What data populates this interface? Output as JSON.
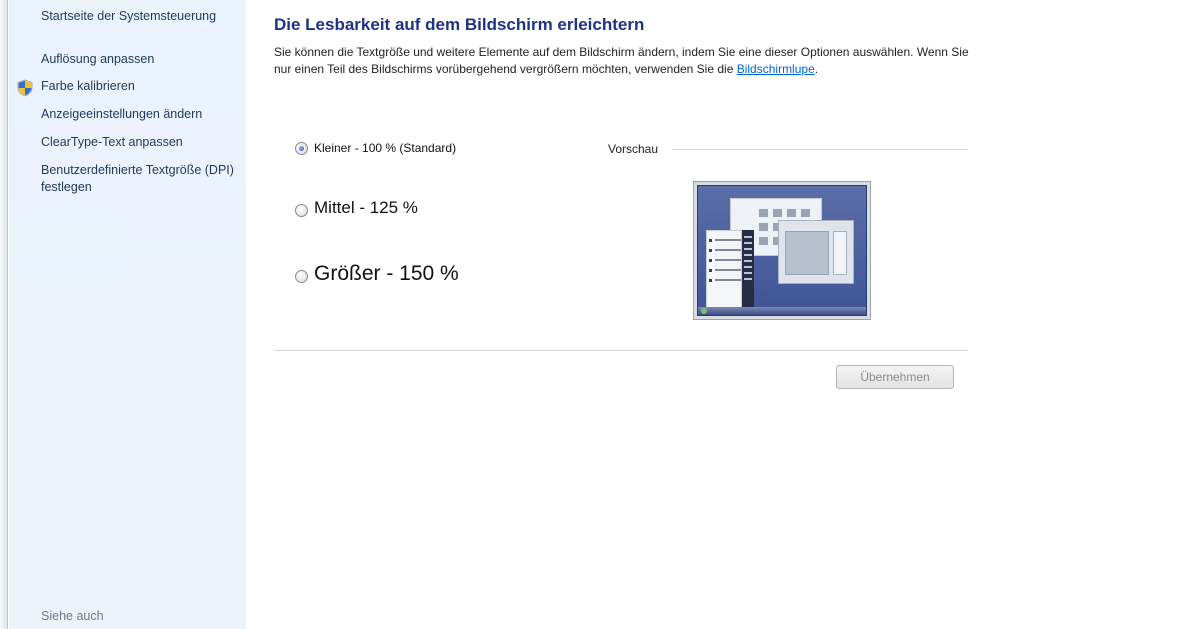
{
  "sidebar": {
    "home_link": "Startseite der Systemsteuerung",
    "items": [
      {
        "label": "Auflösung anpassen"
      },
      {
        "label": "Farbe kalibrieren",
        "icon": "uac-shield-icon"
      },
      {
        "label": "Anzeigeeinstellungen ändern"
      },
      {
        "label": "ClearType-Text anpassen"
      },
      {
        "label": "Benutzerdefinierte Textgröße (DPI) festlegen"
      }
    ],
    "see_also": "Siehe auch"
  },
  "main": {
    "title": "Die Lesbarkeit auf dem Bildschirm erleichtern",
    "description": "Sie können die Textgröße und weitere Elemente auf dem Bildschirm ändern, indem Sie eine dieser Optionen auswählen. Wenn Sie nur einen Teil des Bildschirms vorübergehend vergrößern möchten, verwenden Sie die",
    "description_link": "Bildschirmlupe",
    "description_end": ".",
    "options": [
      {
        "label": "Kleiner - 100 % (Standard)",
        "checked": true
      },
      {
        "label": "Mittel - 125 %",
        "checked": false
      },
      {
        "label": "Größer - 150 %",
        "checked": false
      }
    ],
    "preview_label": "Vorschau",
    "apply_button": "Übernehmen",
    "apply_enabled": false
  },
  "colors": {
    "title": "#1e3287",
    "link": "#0066cc",
    "sidebar_bg": "#eaf2fb",
    "sidebar_text": "#1e395b"
  }
}
